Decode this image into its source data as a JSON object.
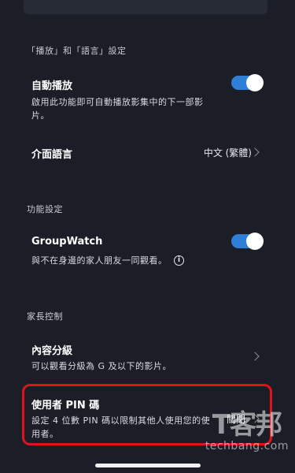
{
  "sections": {
    "playback_language": "「播放」和「語言」設定",
    "features": "功能設定",
    "parental": "家長控制"
  },
  "autoplay": {
    "title": "自動播放",
    "desc_line1": "啟用此功能即可自動播放影集中的下一部影",
    "desc_line2": "片。",
    "enabled": true
  },
  "interface_language": {
    "title": "介面語言",
    "value": "中文 (繁體)"
  },
  "groupwatch": {
    "title": "GroupWatch",
    "desc": "與不在身邊的家人朋友一同觀看。",
    "enabled": true,
    "info_icon": "info-icon"
  },
  "content_rating": {
    "title": "內容分級",
    "desc": "可以觀看分級為 G 及以下的影片。"
  },
  "pin": {
    "title": "使用者 PIN 碼",
    "desc_line1": "設定 4 位數 PIN 碼以限制其他人使用您的使",
    "desc_line2": "用者。",
    "value": "關閉"
  },
  "watermark": {
    "logo": "T客邦",
    "url": "techbang.com"
  },
  "colors": {
    "background": "#1b1e27",
    "toggle_on": "#2f7fd6",
    "highlight": "#e3101f"
  }
}
